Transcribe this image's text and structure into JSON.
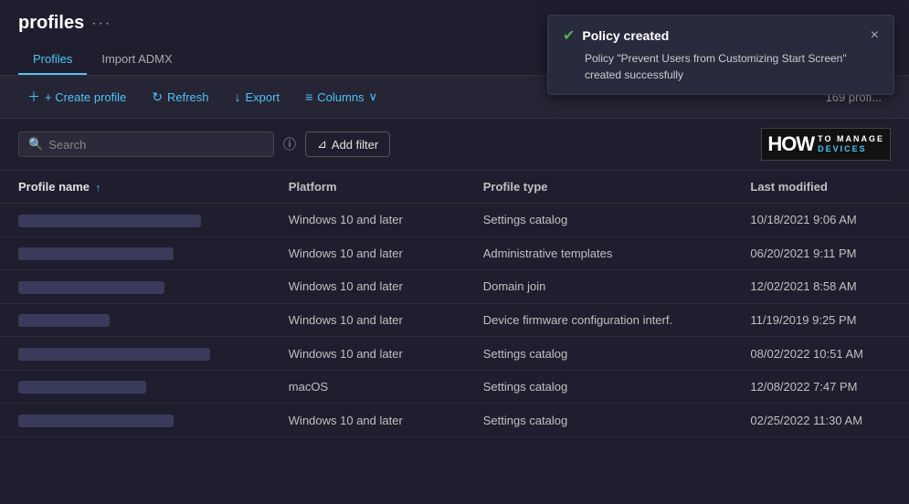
{
  "header": {
    "title_prefix": "",
    "title": "profiles",
    "more_label": "···"
  },
  "tabs": [
    {
      "id": "profiles",
      "label": "Profiles",
      "active": true
    },
    {
      "id": "import-admx",
      "label": "Import ADMX",
      "active": false
    }
  ],
  "toolbar": {
    "create_label": "+ Create profile",
    "refresh_label": "Refresh",
    "export_label": "Export",
    "columns_label": "Columns",
    "profile_count": "169 profi..."
  },
  "filter_bar": {
    "search_placeholder": "Search",
    "add_filter_label": "Add filter"
  },
  "watermark": {
    "how": "HOW",
    "to": "TO",
    "manage": "MANAGE",
    "devices": "DEVICES"
  },
  "table": {
    "columns": [
      {
        "id": "profile-name",
        "label": "Profile name",
        "sort": "asc"
      },
      {
        "id": "platform",
        "label": "Platform"
      },
      {
        "id": "profile-type",
        "label": "Profile type"
      },
      {
        "id": "last-modified",
        "label": "Last modified"
      }
    ],
    "rows": [
      {
        "profile_name_width": 200,
        "platform": "Windows 10 and later",
        "profile_type": "Settings catalog",
        "last_modified": "10/18/2021 9:06 AM"
      },
      {
        "profile_name_width": 170,
        "platform": "Windows 10 and later",
        "profile_type": "Administrative templates",
        "last_modified": "06/20/2021 9:11 PM"
      },
      {
        "profile_name_width": 160,
        "platform": "Windows 10 and later",
        "profile_type": "Domain join",
        "last_modified": "12/02/2021 8:58 AM"
      },
      {
        "profile_name_width": 100,
        "platform": "Windows 10 and later",
        "profile_type": "Device firmware configuration interf.",
        "last_modified": "11/19/2019 9:25 PM"
      },
      {
        "profile_name_width": 210,
        "platform": "Windows 10 and later",
        "profile_type": "Settings catalog",
        "last_modified": "08/02/2022 10:51 AM"
      },
      {
        "profile_name_width": 140,
        "platform": "macOS",
        "profile_type": "Settings catalog",
        "last_modified": "12/08/2022 7:47 PM"
      },
      {
        "profile_name_width": 170,
        "platform": "Windows 10 and later",
        "profile_type": "Settings catalog",
        "last_modified": "02/25/2022 11:30 AM"
      }
    ]
  },
  "notification": {
    "title": "Policy created",
    "body": "Policy \"Prevent Users from Customizing Start Screen\" created successfully",
    "close_label": "×"
  }
}
